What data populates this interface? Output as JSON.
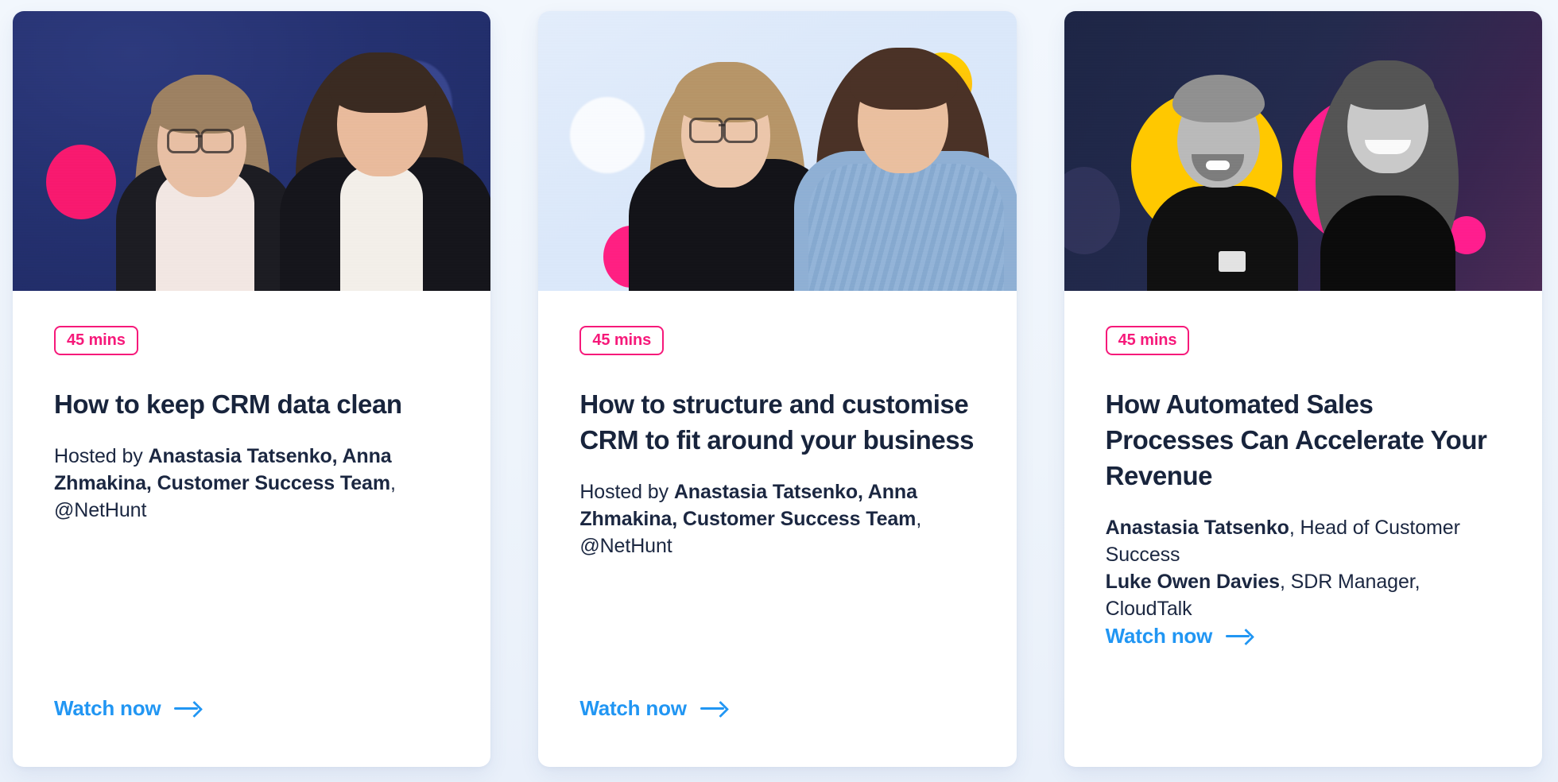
{
  "page": {
    "background_color": "#eef4fb",
    "accent_pink": "#f6197a",
    "accent_blue": "#2196f3",
    "title_color": "#18243c"
  },
  "cards": [
    {
      "badge": "45 mins",
      "title": "How to keep CRM data clean",
      "hosts_prefix": "Hosted by ",
      "hosts_bold": "Anastasia Tatsenko, Anna Zhmakina, Customer Success Team",
      "hosts_suffix": ", @NetHunt",
      "cta": "Watch now",
      "cta_icon": "arrow-right-icon",
      "media": {
        "style": "navy-photo",
        "description": "Two women with arms crossed on dark navy background",
        "blobs": [
          "pink-circle",
          "navy-circle"
        ]
      }
    },
    {
      "badge": "45 mins",
      "title": "How to structure and customise CRM to fit around your business",
      "hosts_prefix": "Hosted by ",
      "hosts_bold": "Anastasia Tatsenko, Anna Zhmakina, Customer Success Team",
      "hosts_suffix": ", @NetHunt",
      "cta": "Watch now",
      "cta_icon": "arrow-right-icon",
      "media": {
        "style": "light-blue-photo",
        "description": "Two women with arms crossed on light blue background",
        "blobs": [
          "yellow-circle",
          "white-circle",
          "pink-circle"
        ]
      }
    },
    {
      "badge": "45 mins",
      "title": "How Automated Sales Processes Can Accelerate Your Revenue",
      "speakers": [
        {
          "name": "Anastasia Tatsenko",
          "role": ", Head of Customer Success"
        },
        {
          "name": "Luke Owen Davies",
          "role": ", SDR Manager, CloudTalk"
        }
      ],
      "cta": "Watch now",
      "cta_icon": "arrow-right-icon",
      "media": {
        "style": "dark-duotone-photo",
        "description": "Black and white headshots of a man and a woman on dark purple background with yellow and pink circles",
        "blobs": [
          "yellow-circle",
          "pink-circle",
          "yellow-dot",
          "pink-dot"
        ]
      }
    }
  ]
}
